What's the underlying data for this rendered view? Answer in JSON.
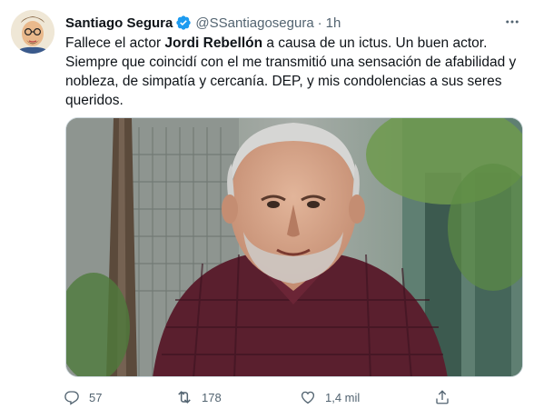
{
  "tweet": {
    "author_name": "Santiago Segura",
    "handle": "@SSantiagosegura",
    "separator": "·",
    "time": "1h",
    "text_before": "Fallece el actor ",
    "text_bold": "Jordi Rebellón",
    "text_after": " a causa de un ictus. Un buen actor. Siempre que coincidí con el me transmitió una sensación de afabilidad y nobleza, de simpatía y cercanía. DEP, y mis condolencias a sus seres queridos.",
    "image_alt": "Portrait of a smiling grey-haired man with a beard in a checked shirt, trees behind"
  },
  "actions": {
    "replies": "57",
    "retweets": "178",
    "likes": "1,4 mil",
    "share": ""
  },
  "colors": {
    "text": "#0f1419",
    "secondary": "#536471",
    "verified": "#1d9bf0"
  },
  "icons": [
    "verified-badge-icon",
    "more-icon",
    "reply-icon",
    "retweet-icon",
    "like-icon",
    "share-icon"
  ]
}
